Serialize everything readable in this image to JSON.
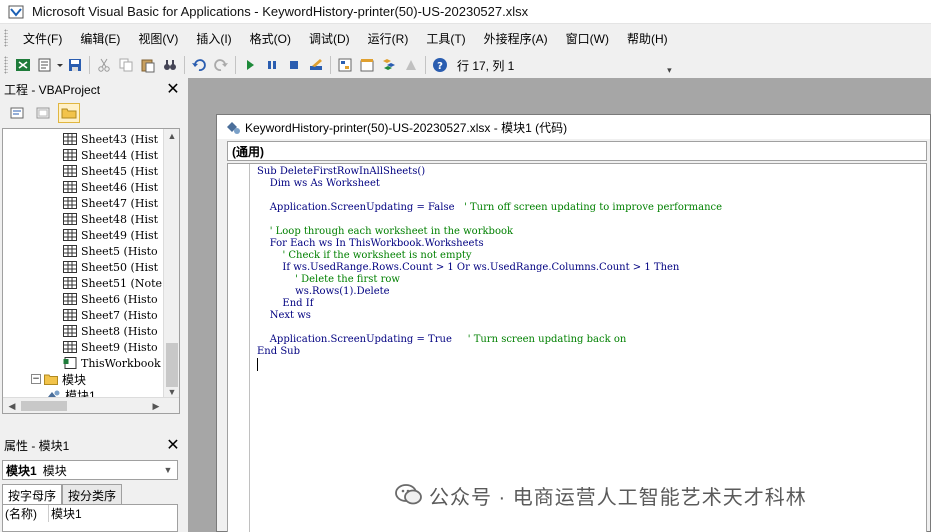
{
  "window": {
    "title": "Microsoft Visual Basic for Applications - KeywordHistory-printer(50)-US-20230527.xlsx"
  },
  "menu": {
    "items": [
      "文件(F)",
      "编辑(E)",
      "视图(V)",
      "插入(I)",
      "格式(O)",
      "调试(D)",
      "运行(R)",
      "工具(T)",
      "外接程序(A)",
      "窗口(W)",
      "帮助(H)"
    ]
  },
  "toolbar": {
    "cursor_position": "行 17, 列 1",
    "icons": [
      "excel-icon",
      "insert-module-icon",
      "save-icon",
      "cut-icon",
      "copy-icon",
      "paste-icon",
      "find-icon",
      "undo-icon",
      "redo-icon",
      "run-icon",
      "break-icon",
      "reset-icon",
      "design-mode-icon",
      "project-explorer-icon",
      "properties-icon",
      "object-browser-icon",
      "toolbox-icon",
      "help-icon"
    ]
  },
  "project_pane": {
    "title": "工程 - VBAProject",
    "tree": [
      {
        "label": "Sheet43 (Hist",
        "type": "sheet"
      },
      {
        "label": "Sheet44 (Hist",
        "type": "sheet"
      },
      {
        "label": "Sheet45 (Hist",
        "type": "sheet"
      },
      {
        "label": "Sheet46 (Hist",
        "type": "sheet"
      },
      {
        "label": "Sheet47 (Hist",
        "type": "sheet"
      },
      {
        "label": "Sheet48 (Hist",
        "type": "sheet"
      },
      {
        "label": "Sheet49 (Hist",
        "type": "sheet"
      },
      {
        "label": "Sheet5 (Histo",
        "type": "sheet"
      },
      {
        "label": "Sheet50 (Hist",
        "type": "sheet"
      },
      {
        "label": "Sheet51 (Note",
        "type": "sheet"
      },
      {
        "label": "Sheet6 (Histo",
        "type": "sheet"
      },
      {
        "label": "Sheet7 (Histo",
        "type": "sheet"
      },
      {
        "label": "Sheet8 (Histo",
        "type": "sheet"
      },
      {
        "label": "Sheet9 (Histo",
        "type": "sheet"
      },
      {
        "label": "ThisWorkbook",
        "type": "workbook"
      },
      {
        "label": "模块",
        "type": "folder"
      },
      {
        "label": "模块1",
        "type": "module"
      }
    ]
  },
  "properties_pane": {
    "title": "属性 - 模块1",
    "selected_object": "模块1",
    "selected_type": "模块",
    "tabs": [
      "按字母序",
      "按分类序"
    ],
    "rows": [
      {
        "key": "(名称)",
        "value": "模块1"
      }
    ]
  },
  "code_window": {
    "title": "KeywordHistory-printer(50)-US-20230527.xlsx - 模块1 (代码)",
    "object_dropdown": "(通用)",
    "lines": [
      {
        "code": "Sub DeleteFirstRowInAllSheets()",
        "comment": ""
      },
      {
        "code": "    Dim ws As Worksheet",
        "comment": ""
      },
      {
        "code": "",
        "comment": ""
      },
      {
        "code": "    Application.ScreenUpdating = False   ",
        "comment": "' Turn off screen updating to improve performance"
      },
      {
        "code": "",
        "comment": ""
      },
      {
        "code": "    ",
        "comment": "' Loop through each worksheet in the workbook"
      },
      {
        "code": "    For Each ws In ThisWorkbook.Worksheets",
        "comment": ""
      },
      {
        "code": "        ",
        "comment": "' Check if the worksheet is not empty"
      },
      {
        "code": "        If ws.UsedRange.Rows.Count > 1 Or ws.UsedRange.Columns.Count > 1 Then",
        "comment": ""
      },
      {
        "code": "            ",
        "comment": "' Delete the first row"
      },
      {
        "code": "            ws.Rows(1).Delete",
        "comment": ""
      },
      {
        "code": "        End If",
        "comment": ""
      },
      {
        "code": "    Next ws",
        "comment": ""
      },
      {
        "code": "",
        "comment": ""
      },
      {
        "code": "    Application.ScreenUpdating = True     ",
        "comment": "' Turn screen updating back on"
      },
      {
        "code": "End Sub",
        "comment": ""
      }
    ]
  },
  "watermark": {
    "text": "公众号 · 电商运营人工智能艺术天才科林"
  }
}
